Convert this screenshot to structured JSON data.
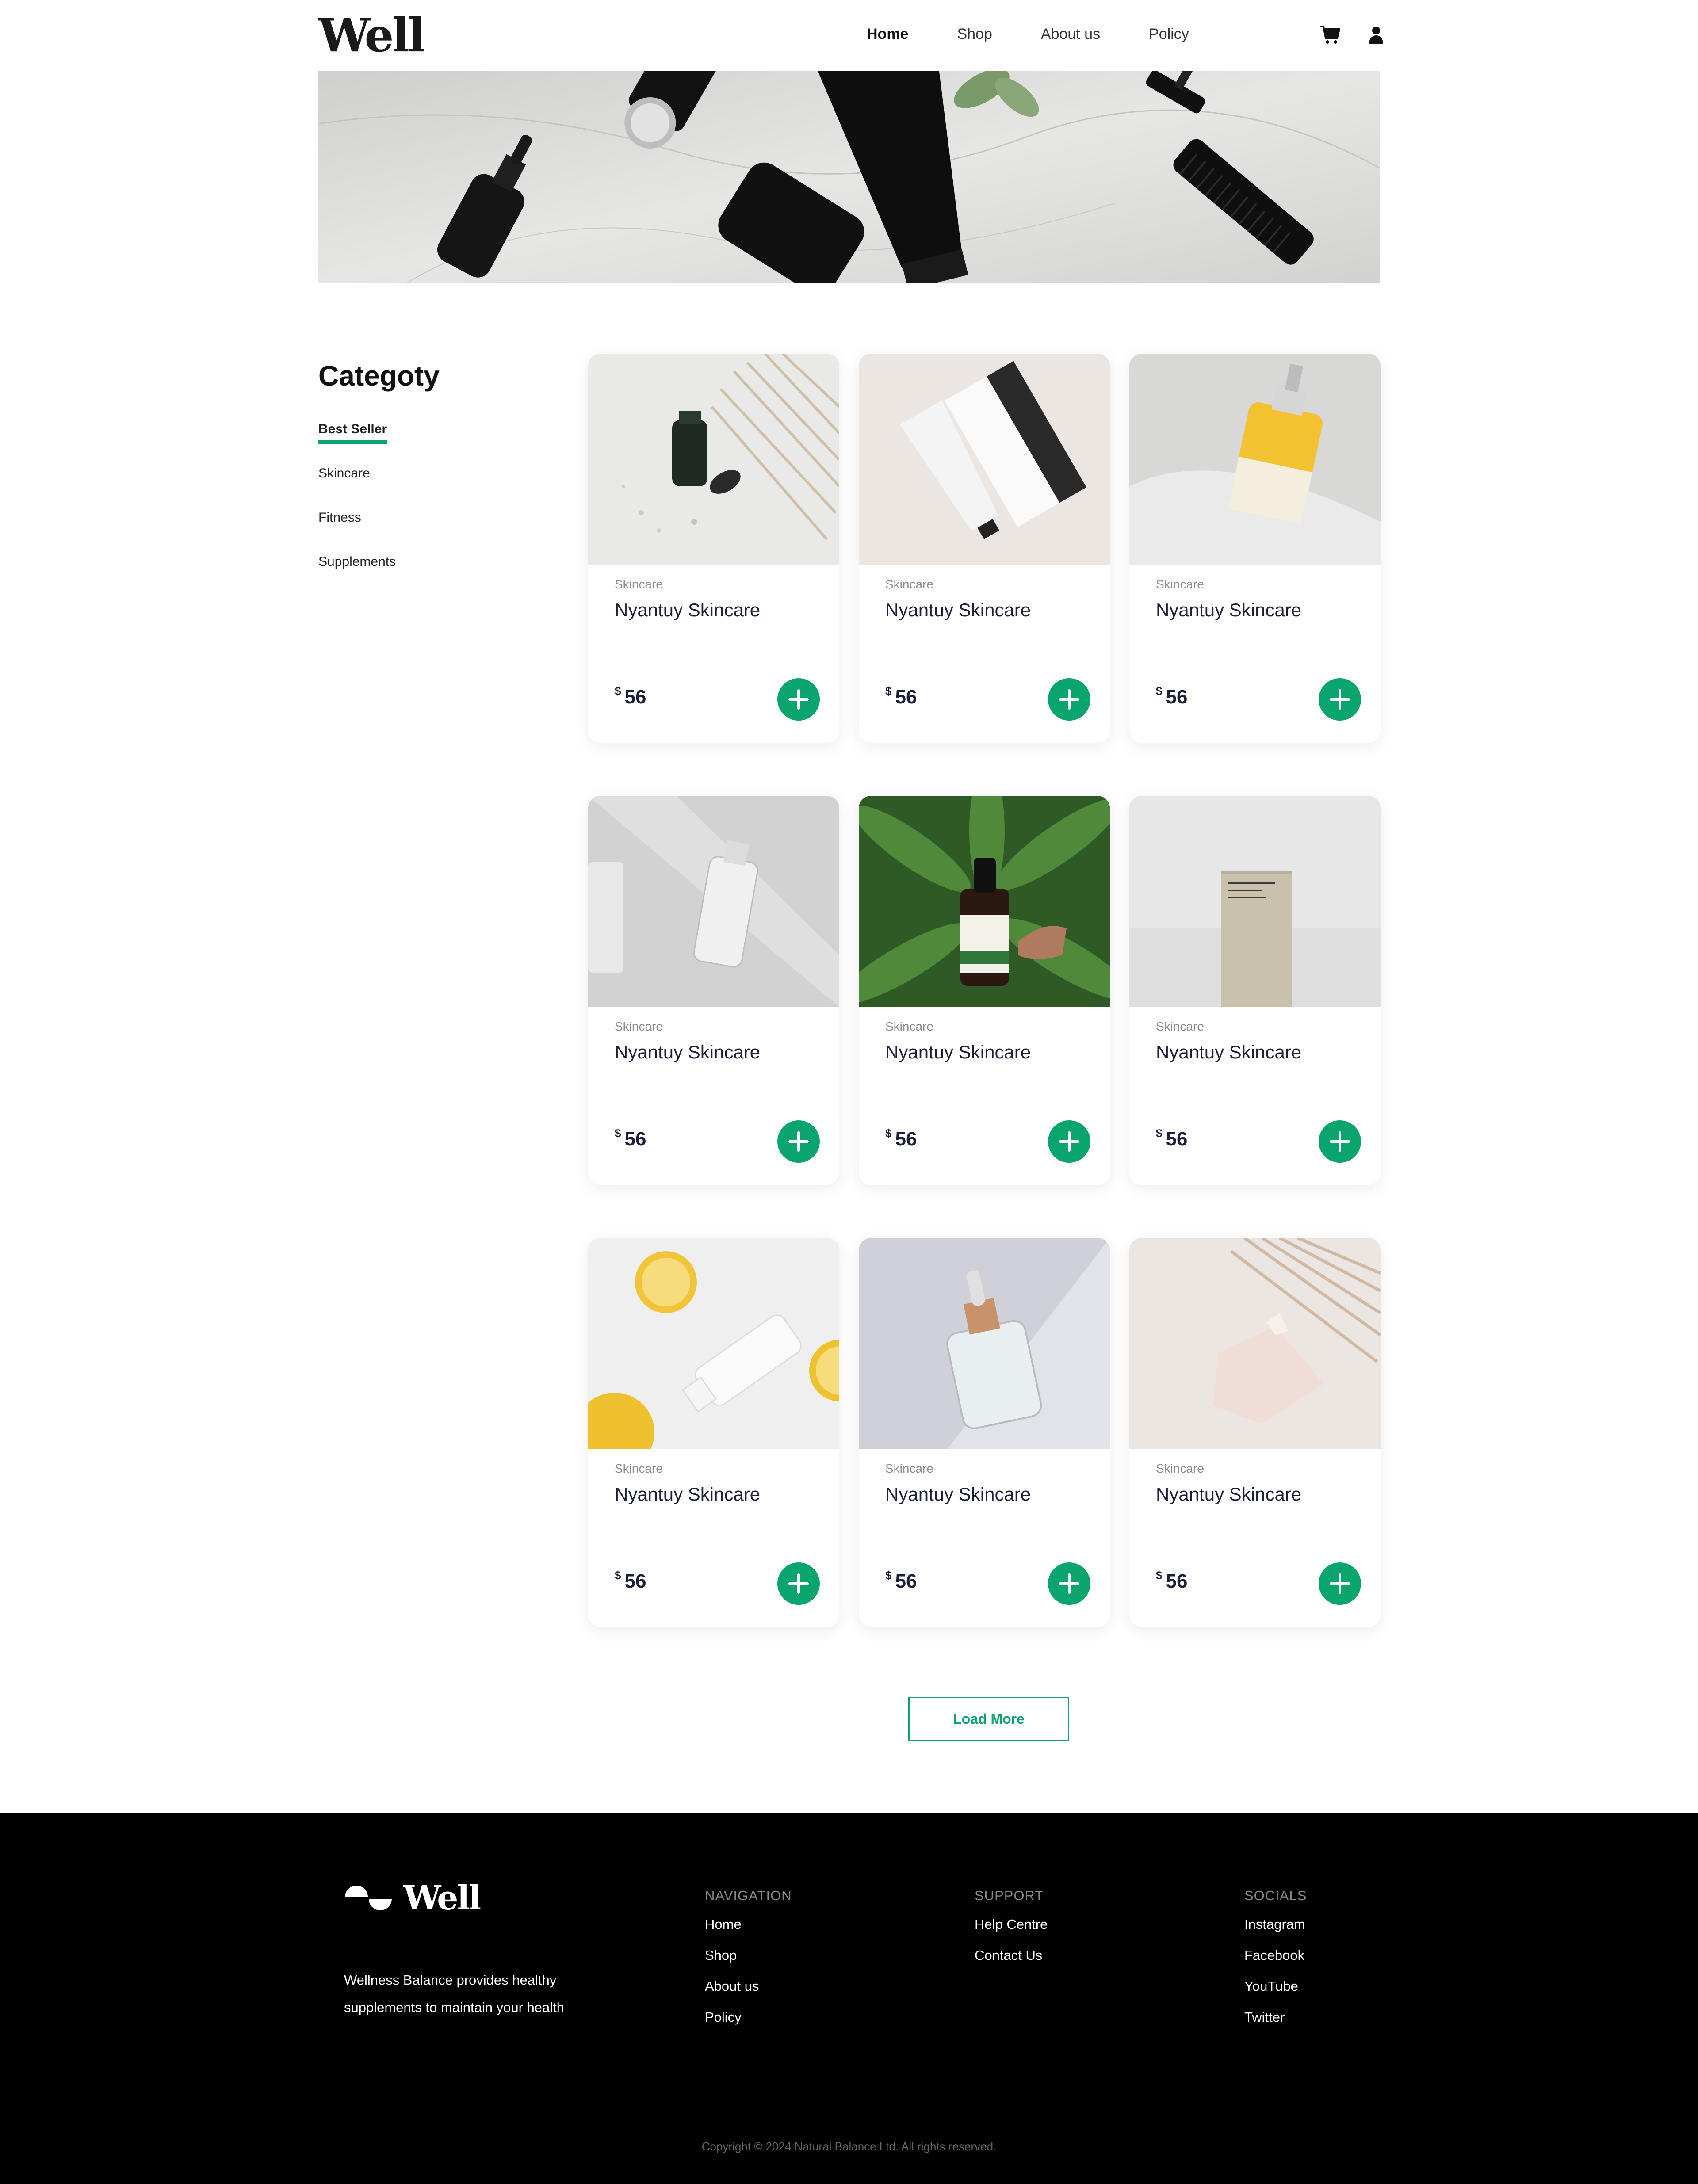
{
  "header": {
    "logo": "Well",
    "nav": [
      "Home",
      "Shop",
      "About us",
      "Policy"
    ],
    "active_nav": "Home",
    "icons": [
      "cart-icon",
      "user-icon"
    ]
  },
  "sidebar": {
    "title": "Categoty",
    "categories": [
      "Best Seller",
      "Skincare",
      "Fitness",
      "Supplements"
    ],
    "active_category": "Best Seller"
  },
  "products": [
    {
      "category": "Skincare",
      "name": "Nyantuy Skincare",
      "currency": "$",
      "price": "56",
      "image": "dropper-bottle-with-pampas"
    },
    {
      "category": "Skincare",
      "name": "Nyantuy Skincare",
      "currency": "$",
      "price": "56",
      "image": "hair-mask-tube-and-box"
    },
    {
      "category": "Skincare",
      "name": "Nyantuy Skincare",
      "currency": "$",
      "price": "56",
      "image": "yellow-serum-bottle"
    },
    {
      "category": "Skincare",
      "name": "Nyantuy Skincare",
      "currency": "$",
      "price": "56",
      "image": "clear-spray-bottle"
    },
    {
      "category": "Skincare",
      "name": "Nyantuy Skincare",
      "currency": "$",
      "price": "56",
      "image": "vitamin-c-dropper-on-leaves"
    },
    {
      "category": "Skincare",
      "name": "Nyantuy Skincare",
      "currency": "$",
      "price": "56",
      "image": "deodorant-box"
    },
    {
      "category": "Skincare",
      "name": "Nyantuy Skincare",
      "currency": "$",
      "price": "56",
      "image": "tube-with-lemons"
    },
    {
      "category": "Skincare",
      "name": "Nyantuy Skincare",
      "currency": "$",
      "price": "56",
      "image": "glass-serum-bottle"
    },
    {
      "category": "Skincare",
      "name": "Nyantuy Skincare",
      "currency": "$",
      "price": "56",
      "image": "pink-pouch-with-pampas"
    }
  ],
  "load_more": "Load More",
  "footer": {
    "logo": "Well",
    "tagline": "Wellness Balance provides healthy supplements to maintain your health",
    "columns": [
      {
        "heading": "NAVIGATION",
        "links": [
          "Home",
          "Shop",
          "About us",
          "Policy"
        ]
      },
      {
        "heading": "SUPPORT",
        "links": [
          "Help Centre",
          "Contact Us"
        ]
      },
      {
        "heading": "SOCIALS",
        "links": [
          "Instagram",
          "Facebook",
          "YouTube",
          "Twitter"
        ]
      }
    ],
    "copyright": "Copyright © 2024 Natural Balance Ltd. All rights reserved."
  },
  "colors": {
    "accent": "#0aa56e",
    "text_dark": "#1b1f3b",
    "footer_bg": "#000000"
  }
}
